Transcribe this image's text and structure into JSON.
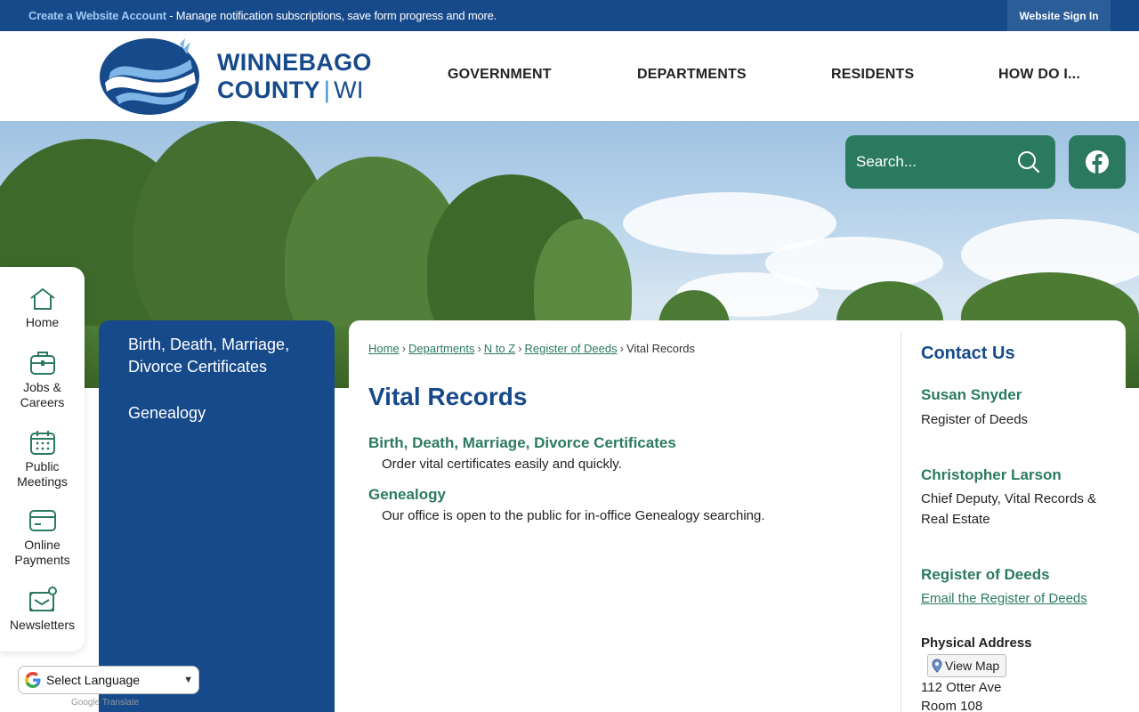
{
  "topbar": {
    "create_account": "Create a Website Account",
    "message": " - Manage notification subscriptions, save form progress and more.",
    "sign_in": "Website Sign In"
  },
  "logo": {
    "line1": "WINNEBAGO",
    "line2": "COUNTY",
    "line2b": "WI"
  },
  "nav": [
    "GOVERNMENT",
    "DEPARTMENTS",
    "RESIDENTS",
    "HOW DO I..."
  ],
  "search": {
    "placeholder": "Search..."
  },
  "quick_links": [
    {
      "label": "Home",
      "icon": "home-icon"
    },
    {
      "label": "Jobs & Careers",
      "icon": "briefcase-icon"
    },
    {
      "label": "Public Meetings",
      "icon": "calendar-icon"
    },
    {
      "label": "Online Payments",
      "icon": "credit-card-icon"
    },
    {
      "label": "Newsletters",
      "icon": "newsletter-icon"
    }
  ],
  "subnav": [
    "Birth, Death, Marriage, Divorce Certificates",
    "Genealogy"
  ],
  "breadcrumb": {
    "links": [
      "Home",
      "Departments",
      "N to Z",
      "Register of Deeds"
    ],
    "current": "Vital Records",
    "separator": "›"
  },
  "page": {
    "title": "Vital Records",
    "items": [
      {
        "title": "Birth, Death, Marriage, Divorce Certificates",
        "desc": "Order vital certificates easily and quickly."
      },
      {
        "title": "Genealogy",
        "desc": "Our office is open to the public for in-office Genealogy searching."
      }
    ]
  },
  "contact": {
    "title": "Contact Us",
    "person1_name": "Susan Snyder",
    "person1_role": "Register of Deeds",
    "person2_name": "Christopher Larson",
    "person2_role": "Chief Deputy, Vital Records & Real Estate",
    "dept_name": "Register of Deeds",
    "email_link": "Email the Register of Deeds",
    "address_heading": "Physical Address",
    "view_map": "View Map",
    "address_line1": "112 Otter Ave",
    "address_line2": "Room 108"
  },
  "translate": {
    "label": "Select Language",
    "powered_by": "Google Translate"
  },
  "colors": {
    "brand_blue": "#174a8b",
    "accent_green": "#2b7a5f",
    "topbar_link": "#9fc9f3"
  }
}
